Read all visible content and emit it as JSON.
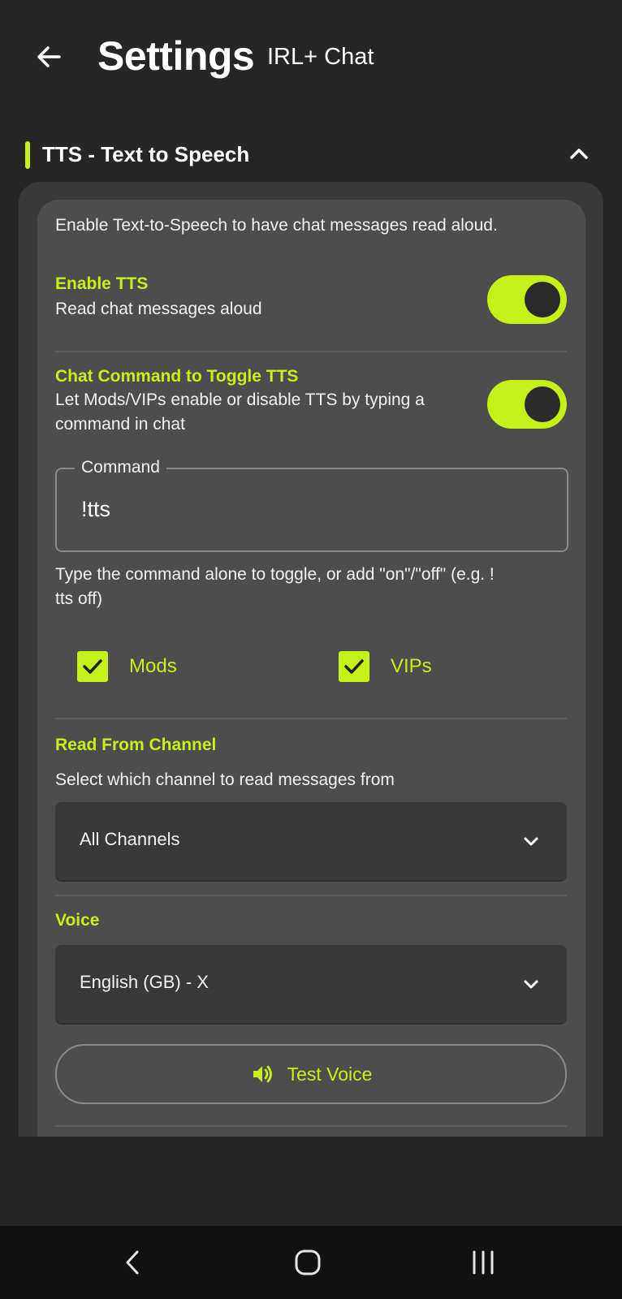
{
  "header": {
    "title": "Settings",
    "subtitle": "IRL+ Chat"
  },
  "section": {
    "title": "TTS - Text to Speech"
  },
  "tts": {
    "intro": "Enable Text-to-Speech to have chat messages read aloud.",
    "enable_tts": {
      "label": "Enable TTS",
      "description": "Read chat messages aloud",
      "enabled": true
    },
    "chat_command": {
      "label": "Chat Command to Toggle TTS",
      "description_line1": "Let Mods/VIPs enable or disable TTS by typing a",
      "description_line2": "command in chat",
      "enabled": true
    },
    "command_field": {
      "label": "Command",
      "value": "!tts"
    },
    "help_line1": "Type the command alone to toggle, or add \"on\"/\"off\" (e.g. !",
    "help_line2": "tts off)",
    "roles": [
      {
        "label": "Mods",
        "checked": true
      },
      {
        "label": "VIPs",
        "checked": true
      }
    ],
    "read_from_channel": {
      "label": "Read From Channel",
      "description": "Select which channel to read messages from",
      "selected": "All Channels"
    },
    "voice": {
      "label": "Voice",
      "selected": "English (GB) - X"
    },
    "test_voice_label": "Test Voice"
  },
  "colors": {
    "accent": "#c6f01a",
    "background": "#262626",
    "card": "#4d4d4d"
  },
  "icons": {
    "back": "arrow-left-icon",
    "collapse": "chevron-up-icon",
    "checkbox": "checkmark-icon",
    "dropdown": "chevron-down-icon",
    "speaker": "speaker-icon",
    "nav_back": "nav-back-icon",
    "nav_home": "nav-home-icon",
    "nav_recents": "nav-recents-icon"
  }
}
